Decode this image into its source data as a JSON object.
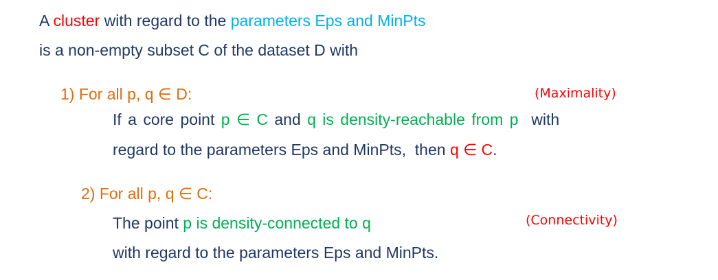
{
  "definition": {
    "line1": {
      "part1": "A ",
      "cluster": "cluster",
      "part2": " with regard to the ",
      "params": "parameters Eps and MinPts"
    },
    "line2": "is a non-empty subset C of the dataset D with"
  },
  "condition1": {
    "header": "1)   For all p, q ∈ D:",
    "label": "(Maximality)",
    "line1": {
      "part1": "If a core point ",
      "p_in": "p ∈ C",
      "and": " and ",
      "reach": "q is density-reachable from p",
      "with": "  with"
    },
    "line2": {
      "part1": "regard to the parameters Eps and MinPts,  then ",
      "q_in": "q ∈ C",
      "period": "."
    }
  },
  "condition2": {
    "header": "2)   For all p, q ∈ C:",
    "label": "(Connectivity)",
    "line1": {
      "part1": "The point ",
      "connected": "p is density-connected to q"
    },
    "line2": "with regard to the parameters Eps and MinPts."
  },
  "colors": {
    "text": "#1f3864",
    "highlight_red": "#ff0000",
    "highlight_cyan": "#00b0f0",
    "header_orange": "#e46c0a",
    "highlight_green": "#00b050"
  }
}
